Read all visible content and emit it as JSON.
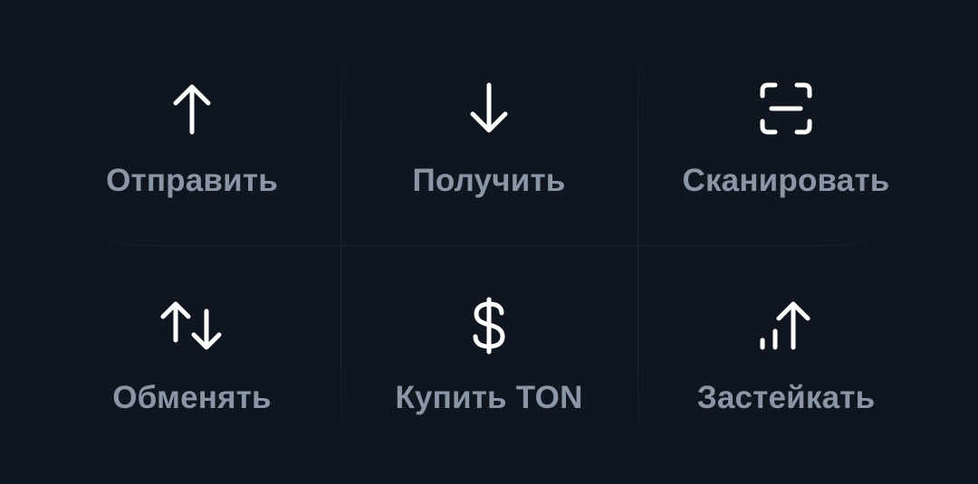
{
  "actions": [
    {
      "label": "Отправить",
      "icon": "arrow-up-icon"
    },
    {
      "label": "Получить",
      "icon": "arrow-down-icon"
    },
    {
      "label": "Сканировать",
      "icon": "scan-icon"
    },
    {
      "label": "Обменять",
      "icon": "swap-arrows-icon"
    },
    {
      "label": "Купить TON",
      "icon": "dollar-icon"
    },
    {
      "label": "Застейкать",
      "icon": "stake-chart-icon"
    }
  ],
  "colors": {
    "background": "#10161f",
    "icon": "#ffffff",
    "label": "#8a95a6",
    "divider": "#1c2430"
  }
}
